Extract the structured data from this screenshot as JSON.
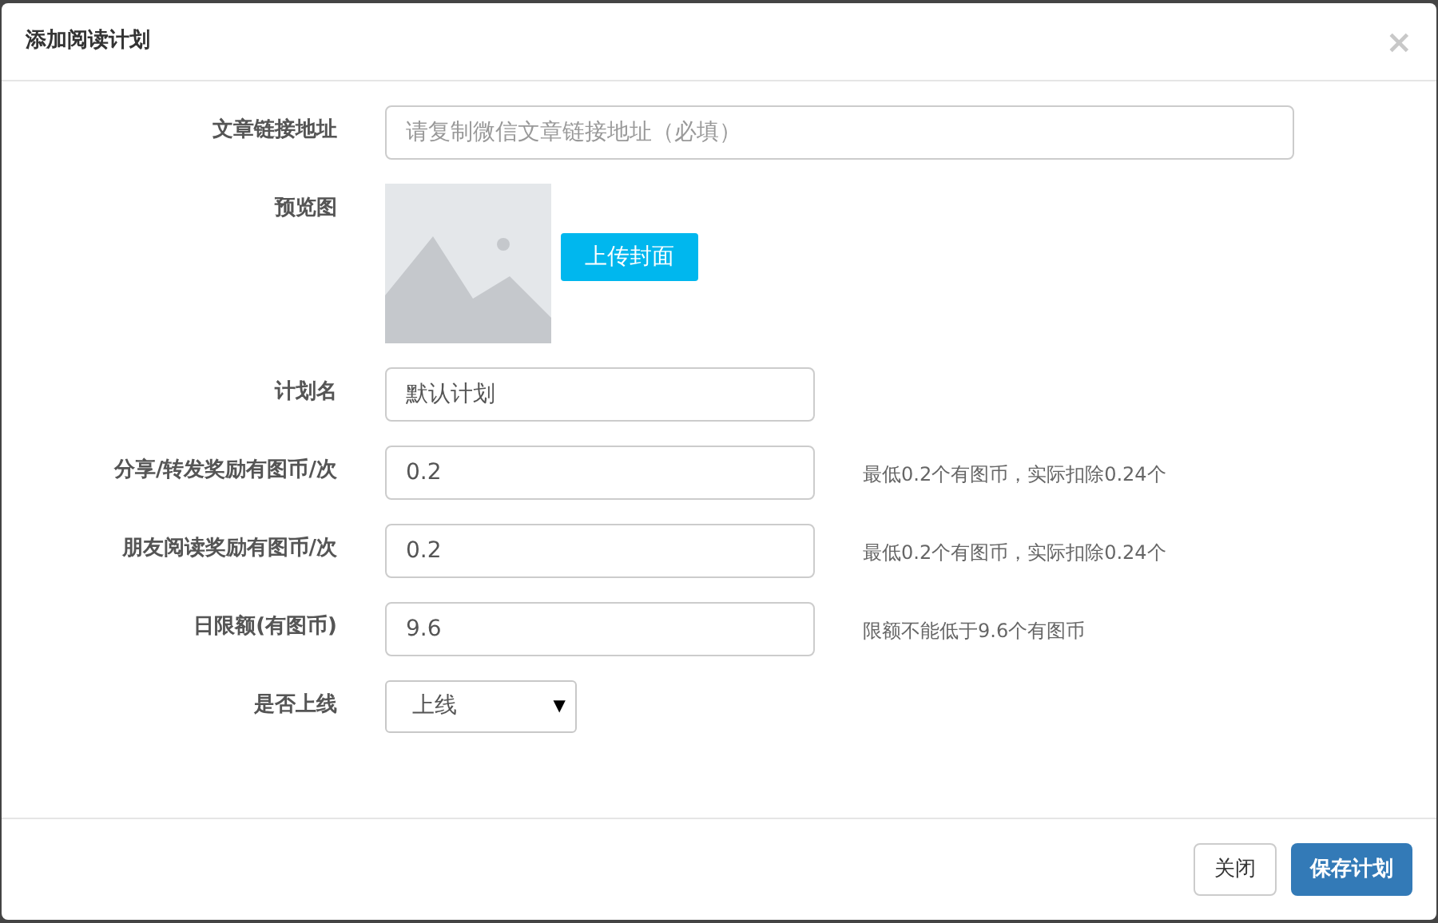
{
  "dialog": {
    "title": "添加阅读计划",
    "close": "×"
  },
  "fields": [
    {
      "kind": "url",
      "label": "文章链接地址",
      "placeholder": "请复制微信文章链接地址（必填）"
    },
    {
      "kind": "upload",
      "label": "预览图",
      "button": "上传封面"
    },
    {
      "kind": "text",
      "label": "计划名",
      "value": "默认计划"
    },
    {
      "kind": "text",
      "label": "分享/转发奖励有图币/次",
      "value": "0.2",
      "hint": "最低0.2个有图币，实际扣除0.24个"
    },
    {
      "kind": "text",
      "label": "朋友阅读奖励有图币/次",
      "value": "0.2",
      "hint": "最低0.2个有图币，实际扣除0.24个"
    },
    {
      "kind": "text",
      "label": "日限额(有图币)",
      "value": "9.6",
      "hint": "限额不能低于9.6个有图币"
    },
    {
      "kind": "select",
      "label": "是否上线",
      "value": "上线",
      "arrow": "▼"
    }
  ],
  "buttons": [
    {
      "label": "关闭",
      "kind": "default"
    },
    {
      "label": "保存计划",
      "kind": "primary"
    }
  ]
}
